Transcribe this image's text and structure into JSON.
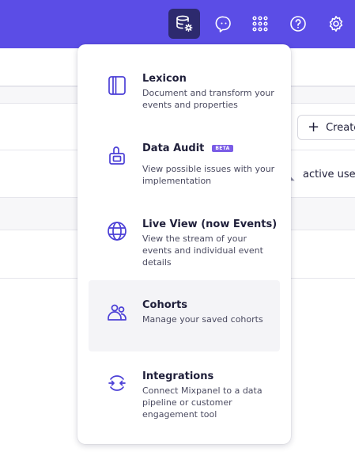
{
  "topbar": {
    "color": "#5b4de6",
    "icons": [
      {
        "name": "data-management-icon",
        "active": true
      },
      {
        "name": "chat-icon"
      },
      {
        "name": "apps-grid-icon"
      },
      {
        "name": "help-icon"
      },
      {
        "name": "settings-gear-icon"
      }
    ]
  },
  "background": {
    "create_label": "Create",
    "search_text": "active user"
  },
  "menu": {
    "items": [
      {
        "title": "Lexicon",
        "desc": "Document and transform your events and properties",
        "icon": "book-icon"
      },
      {
        "title": "Data Audit",
        "badge": "BETA",
        "desc": "View possible issues with your implementation",
        "icon": "audit-icon"
      },
      {
        "title": "Live View (now Events)",
        "desc": "View the stream of your events and individual event details",
        "icon": "globe-icon"
      },
      {
        "title": "Cohorts",
        "desc": "Manage your saved cohorts",
        "icon": "users-icon",
        "highlighted": true
      },
      {
        "title": "Integrations",
        "desc": "Connect Mixpanel to a data pipeline or customer engagement tool",
        "icon": "integrations-icon"
      }
    ]
  }
}
